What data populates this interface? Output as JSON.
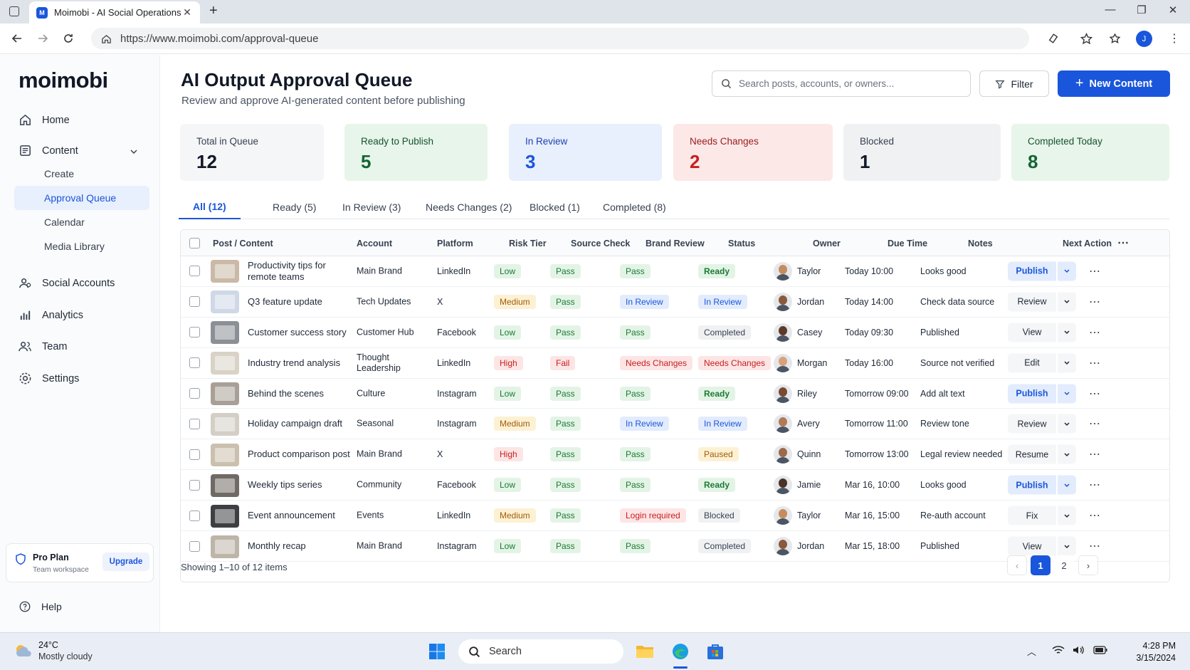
{
  "browser": {
    "tab_title": "Moimobi - AI Social Operations",
    "url": "https://www.moimobi.com/approval-queue",
    "profile_initial": "J",
    "favicon_letter": "M"
  },
  "sidebar": {
    "logo": "moimobi",
    "items": [
      {
        "label": "Home",
        "icon": "home-icon"
      },
      {
        "label": "Content",
        "icon": "content-icon"
      },
      {
        "label": "Social Accounts",
        "icon": "social-accounts-icon"
      },
      {
        "label": "Analytics",
        "icon": "analytics-icon"
      },
      {
        "label": "Team",
        "icon": "team-icon"
      },
      {
        "label": "Settings",
        "icon": "gear-icon"
      }
    ],
    "content_sub": [
      "Create",
      "Approval Queue",
      "Calendar",
      "Media Library"
    ],
    "plan": {
      "title": "Pro Plan",
      "subtitle": "Team workspace",
      "upgrade": "Upgrade"
    },
    "help": "Help"
  },
  "header": {
    "title": "AI Output Approval Queue",
    "subtitle": "Review and approve AI-generated content before publishing",
    "search_placeholder": "Search posts, accounts, or owners...",
    "filter": "Filter",
    "new_content": "New Content"
  },
  "stats": [
    {
      "label": "Total in Queue",
      "value": "12"
    },
    {
      "label": "Ready to Publish",
      "value": "5"
    },
    {
      "label": "In Review",
      "value": "3"
    },
    {
      "label": "Needs Changes",
      "value": "2"
    },
    {
      "label": "Blocked",
      "value": "1"
    },
    {
      "label": "Completed Today",
      "value": "8"
    }
  ],
  "tabs": [
    "All (12)",
    "Ready (5)",
    "In Review (3)",
    "Needs Changes (2)",
    "Blocked (1)",
    "Completed (8)"
  ],
  "columns": [
    "Post / Content",
    "Account",
    "Platform",
    "Risk Tier",
    "Source Check",
    "Brand Review",
    "Status",
    "Owner",
    "Due Time",
    "Notes",
    "Next Action"
  ],
  "rows": [
    {
      "title": "Productivity tips for remote teams",
      "account": "Main Brand",
      "platform": "LinkedIn",
      "risk": "Low",
      "source": "Pass",
      "brand": "Pass",
      "status": "Ready",
      "owner": "Taylor",
      "due": "Today 10:00",
      "notes": "Looks good",
      "action": "Publish"
    },
    {
      "title": "Q3 feature update",
      "account": "Tech Updates",
      "platform": "X",
      "risk": "Medium",
      "source": "Pass",
      "brand": "In Review",
      "status": "In Review",
      "owner": "Jordan",
      "due": "Today 14:00",
      "notes": "Check data source",
      "action": "Review"
    },
    {
      "title": "Customer success story",
      "account": "Customer Hub",
      "platform": "Facebook",
      "risk": "Low",
      "source": "Pass",
      "brand": "Pass",
      "status": "Completed",
      "owner": "Casey",
      "due": "Today 09:30",
      "notes": "Published",
      "action": "View"
    },
    {
      "title": "Industry trend analysis",
      "account": "Thought Leadership",
      "platform": "LinkedIn",
      "risk": "High",
      "source": "Fail",
      "brand": "Needs Changes",
      "status": "Needs Changes",
      "owner": "Morgan",
      "due": "Today 16:00",
      "notes": "Source not verified",
      "action": "Edit"
    },
    {
      "title": "Behind the scenes",
      "account": "Culture",
      "platform": "Instagram",
      "risk": "Low",
      "source": "Pass",
      "brand": "Pass",
      "status": "Ready",
      "owner": "Riley",
      "due": "Tomorrow 09:00",
      "notes": "Add alt text",
      "action": "Publish"
    },
    {
      "title": "Holiday campaign draft",
      "account": "Seasonal",
      "platform": "Instagram",
      "risk": "Medium",
      "source": "Pass",
      "brand": "In Review",
      "status": "In Review",
      "owner": "Avery",
      "due": "Tomorrow 11:00",
      "notes": "Review tone",
      "action": "Review"
    },
    {
      "title": "Product comparison post",
      "account": "Main Brand",
      "platform": "X",
      "risk": "High",
      "source": "Pass",
      "brand": "Pass",
      "status": "Paused",
      "owner": "Quinn",
      "due": "Tomorrow 13:00",
      "notes": "Legal review needed",
      "action": "Resume"
    },
    {
      "title": "Weekly tips series",
      "account": "Community",
      "platform": "Facebook",
      "risk": "Low",
      "source": "Pass",
      "brand": "Pass",
      "status": "Ready",
      "owner": "Jamie",
      "due": "Mar 16, 10:00",
      "notes": "Looks good",
      "action": "Publish"
    },
    {
      "title": "Event announcement",
      "account": "Events",
      "platform": "LinkedIn",
      "risk": "Medium",
      "source": "Pass",
      "brand": "Login required",
      "status": "Blocked",
      "owner": "Taylor",
      "due": "Mar 16, 15:00",
      "notes": "Re-auth account",
      "action": "Fix"
    },
    {
      "title": "Monthly recap",
      "account": "Main Brand",
      "platform": "Instagram",
      "risk": "Low",
      "source": "Pass",
      "brand": "Pass",
      "status": "Completed",
      "owner": "Jordan",
      "due": "Mar 15, 18:00",
      "notes": "Published",
      "action": "View"
    }
  ],
  "footer": {
    "showing": "Showing 1–10 of 12 items",
    "pages": [
      "1",
      "2"
    ]
  },
  "taskbar": {
    "temp": "24°C",
    "weather": "Mostly cloudy",
    "search": "Search",
    "time": "4:28 PM",
    "date": "3/15/2024"
  },
  "colors": {
    "accent": "#1a56db"
  }
}
